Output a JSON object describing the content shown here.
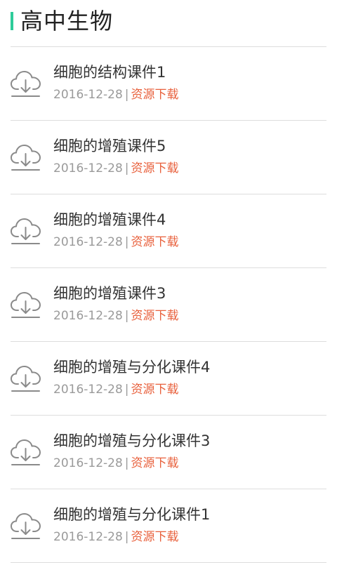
{
  "header": {
    "title": "高中生物",
    "accent_color": "#2ecc9a"
  },
  "colors": {
    "link": "#e8603c",
    "meta": "#9a9a9a",
    "divider": "#dddddd"
  },
  "items": [
    {
      "icon": "cloud-download-icon",
      "title": "细胞的结构课件1",
      "date": "2016-12-28",
      "separator": "|",
      "link_label": "资源下载"
    },
    {
      "icon": "cloud-download-icon",
      "title": "细胞的增殖课件5",
      "date": "2016-12-28",
      "separator": "|",
      "link_label": "资源下载"
    },
    {
      "icon": "cloud-download-icon",
      "title": "细胞的增殖课件4",
      "date": "2016-12-28",
      "separator": "|",
      "link_label": "资源下载"
    },
    {
      "icon": "cloud-download-icon",
      "title": "细胞的增殖课件3",
      "date": "2016-12-28",
      "separator": "|",
      "link_label": "资源下载"
    },
    {
      "icon": "cloud-download-icon",
      "title": "细胞的增殖与分化课件4",
      "date": "2016-12-28",
      "separator": "|",
      "link_label": "资源下载"
    },
    {
      "icon": "cloud-download-icon",
      "title": "细胞的增殖与分化课件3",
      "date": "2016-12-28",
      "separator": "|",
      "link_label": "资源下载"
    },
    {
      "icon": "cloud-download-icon",
      "title": "细胞的增殖与分化课件1",
      "date": "2016-12-28",
      "separator": "|",
      "link_label": "资源下载"
    }
  ]
}
